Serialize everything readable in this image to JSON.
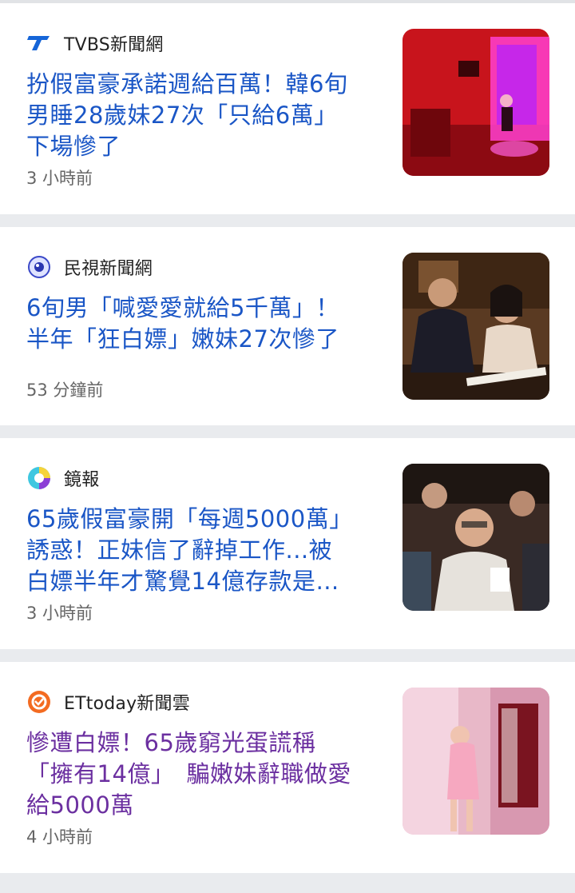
{
  "articles": [
    {
      "source": "TVBS新聞網",
      "source_icon": "tvbs-logo-icon",
      "headline_lines": [
        "扮假富豪承諾週給百萬！韓6旬",
        "男睡28歲妹27次「只給6萬」",
        "下場慘了"
      ],
      "time": "3 小時前",
      "visited": false
    },
    {
      "source": "民視新聞網",
      "source_icon": "ftv-eye-logo-icon",
      "headline_lines": [
        "6旬男「喊愛愛就給5千萬」！",
        "半年「狂白嫖」嫩妹27次慘了"
      ],
      "time": "53 分鐘前",
      "visited": false
    },
    {
      "source": "鏡報",
      "source_icon": "mirror-news-logo-icon",
      "headline_lines": [
        "65歲假富豪開「每週5000萬」",
        "誘惑！正妹信了辭掉工作...被",
        "白嫖半年才驚覺14億存款是…"
      ],
      "time": "3 小時前",
      "visited": false
    },
    {
      "source": "ETtoday新聞雲",
      "source_icon": "ettoday-logo-icon",
      "headline_lines": [
        "慘遭白嫖！65歲窮光蛋謊稱",
        "「擁有14億」　騙嫩妹辭職做愛",
        "給5000萬"
      ],
      "time": "4 小時前",
      "visited": true
    }
  ],
  "colors": {
    "headline": "#1a56c6",
    "headline_visited": "#6b2fa0",
    "divider": "#e9ebee"
  }
}
